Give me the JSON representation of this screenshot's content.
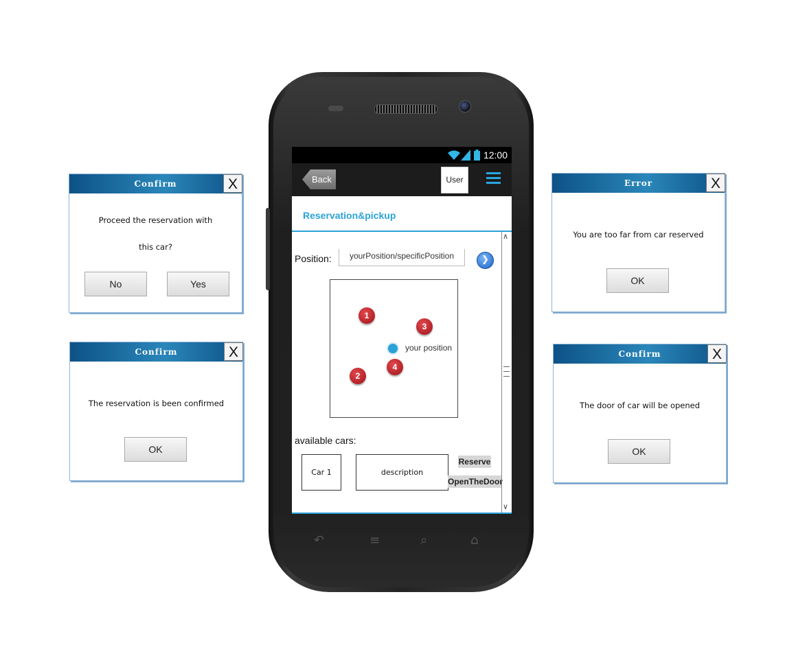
{
  "dialogs": {
    "confirm_reservation": {
      "title": "Confirm",
      "close": "X",
      "message_line1": "Proceed the reservation with",
      "message_line2": "this car?",
      "no_label": "No",
      "yes_label": "Yes"
    },
    "confirmed": {
      "title": "Confirm",
      "close": "X",
      "message": "The reservation is been confirmed",
      "ok_label": "OK"
    },
    "error": {
      "title": "Error",
      "close": "X",
      "message": "You are too far from car reserved",
      "ok_label": "OK"
    },
    "door": {
      "title": "Confirm",
      "close": "X",
      "message": "The door of car will be opened",
      "ok_label": "OK"
    }
  },
  "phone": {
    "status_bar": {
      "time": "12:00"
    },
    "action_bar": {
      "back_label": "Back",
      "user_label": "User"
    },
    "page_title": "Reservation&pickup",
    "position": {
      "label": "Position:",
      "value": "yourPosition/specificPosition"
    },
    "map": {
      "pins": [
        "1",
        "2",
        "3",
        "4"
      ],
      "you_label": "your position"
    },
    "available_cars": {
      "label": "available cars:",
      "items": [
        {
          "name": "Car 1",
          "description": "description",
          "reserve_label": "Reserve",
          "open_label": "OpenTheDoor"
        }
      ]
    }
  }
}
